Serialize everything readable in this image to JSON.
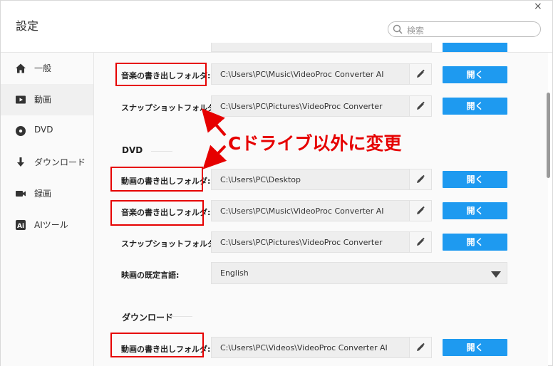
{
  "window": {
    "title": "設定",
    "close": "×"
  },
  "search": {
    "placeholder": "検索"
  },
  "sidebar": {
    "items": [
      {
        "label": "一般",
        "icon": "home-icon",
        "active": false
      },
      {
        "label": "動画",
        "icon": "video-play-icon",
        "active": true
      },
      {
        "label": "DVD",
        "icon": "disc-icon",
        "active": false
      },
      {
        "label": "ダウンロード",
        "icon": "download-icon",
        "active": false
      },
      {
        "label": "録画",
        "icon": "camera-icon",
        "active": false
      },
      {
        "label": "AIツール",
        "icon": "ai-icon",
        "active": false
      }
    ]
  },
  "video_section": {
    "music_export": {
      "label": "音楽の書き出しフォルダ:",
      "value": "C:\\Users\\PC\\Music\\VideoProc Converter AI",
      "button": "開く"
    },
    "snapshot": {
      "label": "スナップショットフォルダ:",
      "value": "C:\\Users\\PC\\Pictures\\VideoProc Converter",
      "button": "開く"
    }
  },
  "dvd_section": {
    "title": "DVD",
    "video_export": {
      "label": "動画の書き出しフォルダ:",
      "value": "C:\\Users\\PC\\Desktop",
      "button": "開く"
    },
    "music_export": {
      "label": "音楽の書き出しフォルダ:",
      "value": "C:\\Users\\PC\\Music\\VideoProc Converter AI",
      "button": "開く"
    },
    "snapshot": {
      "label": "スナップショットフォルダ:",
      "value": "C:\\Users\\PC\\Pictures\\VideoProc Converter",
      "button": "開く"
    },
    "language": {
      "label": "映画の既定言語:",
      "value": "English"
    }
  },
  "download_section": {
    "title": "ダウンロード",
    "video_export": {
      "label": "動画の書き出しフォルダ:",
      "value": "C:\\Users\\PC\\Videos\\VideoProc Converter AI",
      "button": "開く"
    }
  },
  "annotation": {
    "text": "Cドライブ以外に変更",
    "color": "#e60000"
  },
  "colors": {
    "accent": "#1e9af0",
    "highlight": "#e60000"
  }
}
